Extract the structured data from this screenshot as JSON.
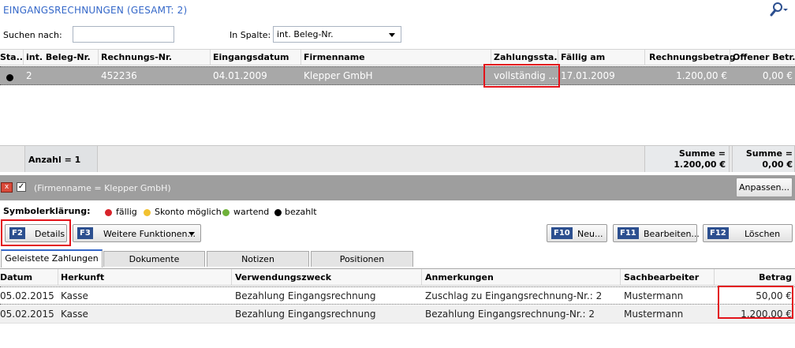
{
  "header": {
    "title": "EINGANGSRECHNUNGEN (GESAMT: 2)",
    "search_icon": "search-options-icon"
  },
  "search": {
    "search_label": "Suchen nach:",
    "search_value": "",
    "column_label": "In Spalte:",
    "column_selected": "int. Beleg-Nr."
  },
  "grid": {
    "columns": [
      "Sta...",
      "int. Beleg-Nr.",
      "Rechnungs-Nr.",
      "Eingangsdatum",
      "Firmenname",
      "Zahlungssta...",
      "Fällig am",
      "Rechnungsbetrag",
      "Offener Betr..."
    ],
    "rows": [
      {
        "status_color": "#000000",
        "beleg_nr": "2",
        "rechnungs_nr": "452236",
        "eingangsdatum": "04.01.2009",
        "firmenname": "Klepper GmbH",
        "zahlungsstatus": "vollständig ...",
        "faellig_am": "17.01.2009",
        "rechnungsbetrag": "1.200,00 €",
        "offener_betrag": "0,00 €"
      }
    ],
    "footer": {
      "anzahl": "Anzahl = 1",
      "summe1_label": "Summe =",
      "summe1_value": "1.200,00 €",
      "summe2_label": "Summe =",
      "summe2_value": "0,00 €"
    }
  },
  "filter": {
    "close_label": "x",
    "checked": "✓",
    "text": "(Firmenname = Klepper GmbH)",
    "anpassen_label": "Anpassen..."
  },
  "legend": {
    "title": "Symbolerklärung:",
    "items": [
      {
        "label": "fällig",
        "color": "#d8232a"
      },
      {
        "label": "Skonto möglich",
        "color": "#f2c230"
      },
      {
        "label": "wartend",
        "color": "#6fb23a"
      },
      {
        "label": "bezahlt",
        "color": "#000000"
      }
    ]
  },
  "toolbar": {
    "details_key": "F2",
    "details_label": "Details",
    "weitere_key": "F3",
    "weitere_label": "Weitere Funktionen...",
    "neu_key": "F10",
    "neu_label": "Neu...",
    "bearbeiten_key": "F11",
    "bearbeiten_label": "Bearbeiten...",
    "loeschen_key": "F12",
    "loeschen_label": "Löschen"
  },
  "tabs": [
    {
      "label": "Geleistete Zahlungen",
      "active": true
    },
    {
      "label": "Dokumente",
      "active": false
    },
    {
      "label": "Notizen",
      "active": false
    },
    {
      "label": "Positionen",
      "active": false
    }
  ],
  "payments": {
    "columns": [
      "Datum",
      "Herkunft",
      "Verwendungszweck",
      "Anmerkungen",
      "Sachbearbeiter",
      "Betrag"
    ],
    "rows": [
      {
        "datum": "05.02.2015",
        "herkunft": "Kasse",
        "zweck": "Bezahlung Eingangsrechnung",
        "anmerkung": "Zuschlag zu Eingangsrechnung-Nr.: 2",
        "sachbearbeiter": "Mustermann",
        "betrag": "50,00 €"
      },
      {
        "datum": "05.02.2015",
        "herkunft": "Kasse",
        "zweck": "Bezahlung Eingangsrechnung",
        "anmerkung": "Bezahlung Eingangsrechnung-Nr.: 2",
        "sachbearbeiter": "Mustermann",
        "betrag": "1.200,00 €"
      }
    ]
  },
  "colors": {
    "accent": "#3568c9",
    "highlight": "#e3131a",
    "selected_row": "#a8a8a8",
    "fkey": "#2c4f8f"
  }
}
